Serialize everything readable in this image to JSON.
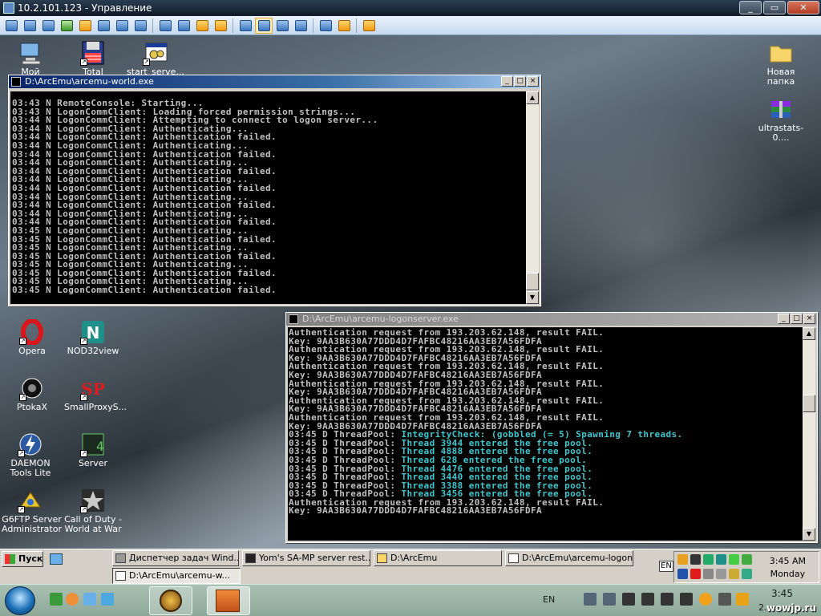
{
  "rdp": {
    "title": "10.2.101.123 - Управление",
    "minimize": "_",
    "restore": "▭",
    "close": "✕"
  },
  "desktop": {
    "icons": [
      {
        "label": "Мой"
      },
      {
        "label": "Total"
      },
      {
        "label": "start_serve..."
      },
      {
        "label": "Новая папка"
      },
      {
        "label": "ultrastats-0...."
      },
      {
        "label": "Opera"
      },
      {
        "label": "NOD32view"
      },
      {
        "label": "PtokaX"
      },
      {
        "label": "SmallProxyS..."
      },
      {
        "label": "DAEMON Tools Lite"
      },
      {
        "label": "Server"
      },
      {
        "label": "G6FTP Server Administrator"
      },
      {
        "label": "Call of Duty - World at War"
      }
    ]
  },
  "world": {
    "title": "D:\\ArcEmu\\arcemu-world.exe",
    "lines": [
      "03:43 N RemoteConsole: Starting...",
      "03:43 N LogonCommClient: Loading forced permission strings...",
      "03:44 N LogonCommClient: Attempting to connect to logon server...",
      "03:44 N LogonCommClient: Authenticating...",
      "03:44 N LogonCommClient: Authentication failed.",
      "03:44 N LogonCommClient: Authenticating...",
      "03:44 N LogonCommClient: Authentication failed.",
      "03:44 N LogonCommClient: Authenticating...",
      "03:44 N LogonCommClient: Authentication failed.",
      "03:44 N LogonCommClient: Authenticating...",
      "03:44 N LogonCommClient: Authentication failed.",
      "03:44 N LogonCommClient: Authenticating...",
      "03:44 N LogonCommClient: Authentication failed.",
      "03:44 N LogonCommClient: Authenticating...",
      "03:44 N LogonCommClient: Authentication failed.",
      "03:45 N LogonCommClient: Authenticating...",
      "03:45 N LogonCommClient: Authentication failed.",
      "03:45 N LogonCommClient: Authenticating...",
      "03:45 N LogonCommClient: Authentication failed.",
      "03:45 N LogonCommClient: Authenticating...",
      "03:45 N LogonCommClient: Authentication failed.",
      "03:45 N LogonCommClient: Authenticating...",
      "03:45 N LogonCommClient: Authentication failed."
    ]
  },
  "logon": {
    "title": "D:\\ArcEmu\\arcemu-logonserver.exe",
    "lines": [
      {
        "t": "Authentication request from 193.203.62.148, result FAIL."
      },
      {
        "t": "Key: 9AA3B630A77DDD4D7FAFBC48216AA3EB7A56FDFA"
      },
      {
        "t": "Authentication request from 193.203.62.148, result FAIL."
      },
      {
        "t": "Key: 9AA3B630A77DDD4D7FAFBC48216AA3EB7A56FDFA"
      },
      {
        "t": "Authentication request from 193.203.62.148, result FAIL."
      },
      {
        "t": "Key: 9AA3B630A77DDD4D7FAFBC48216AA3EB7A56FDFA"
      },
      {
        "t": "Authentication request from 193.203.62.148, result FAIL."
      },
      {
        "t": "Key: 9AA3B630A77DDD4D7FAFBC48216AA3EB7A56FDFA"
      },
      {
        "t": "Authentication request from 193.203.62.148, result FAIL."
      },
      {
        "t": "Key: 9AA3B630A77DDD4D7FAFBC48216AA3EB7A56FDFA"
      },
      {
        "t": "Authentication request from 193.203.62.148, result FAIL."
      },
      {
        "t": "Key: 9AA3B630A77DDD4D7FAFBC48216AA3EB7A56FDFA"
      },
      {
        "t": "03:45 D ThreadPool: ",
        "c": "IntegrityCheck: (gobbled (= 5) Spawning 7 threads."
      },
      {
        "t": "03:45 D ThreadPool: ",
        "c": "Thread 3944 entered the free pool."
      },
      {
        "t": "03:45 D ThreadPool: ",
        "c": "Thread 4888 entered the free pool."
      },
      {
        "t": "03:45 D ThreadPool: ",
        "c": "Thread 628 entered the free pool."
      },
      {
        "t": "03:45 D ThreadPool: ",
        "c": "Thread 4476 entered the free pool."
      },
      {
        "t": "03:45 D ThreadPool: ",
        "c": "Thread 3440 entered the free pool."
      },
      {
        "t": "03:45 D ThreadPool: ",
        "c": "Thread 3388 entered the free pool."
      },
      {
        "t": "03:45 D ThreadPool: ",
        "c": "Thread 3456 entered the free pool."
      },
      {
        "t": "Authentication request from 193.203.62.148, result FAIL."
      },
      {
        "t": "Key: 9AA3B630A77DDD4D7FAFBC48216AA3EB7A56FDFA"
      }
    ]
  },
  "taskbar": {
    "start": "Пуск",
    "buttons": [
      {
        "label": "Диспетчер задач Wind..."
      },
      {
        "label": "Yom's SA-MP server rest..."
      },
      {
        "label": "D:\\ArcEmu"
      },
      {
        "label": "D:\\ArcEmu\\arcemu-logon..."
      },
      {
        "label": "D:\\ArcEmu\\arcemu-w..."
      }
    ],
    "lang": "EN",
    "time": "3:45 AM",
    "day": "Monday"
  },
  "win7": {
    "lang": "EN",
    "time": "3:45",
    "date": "2...",
    "watermark": "wowjp.ru"
  },
  "colors": {
    "console_bg": "#000000",
    "console_text": "#c0c0c0",
    "console_cyan": "#3ec7cf",
    "caption_active": "#0a246a"
  }
}
